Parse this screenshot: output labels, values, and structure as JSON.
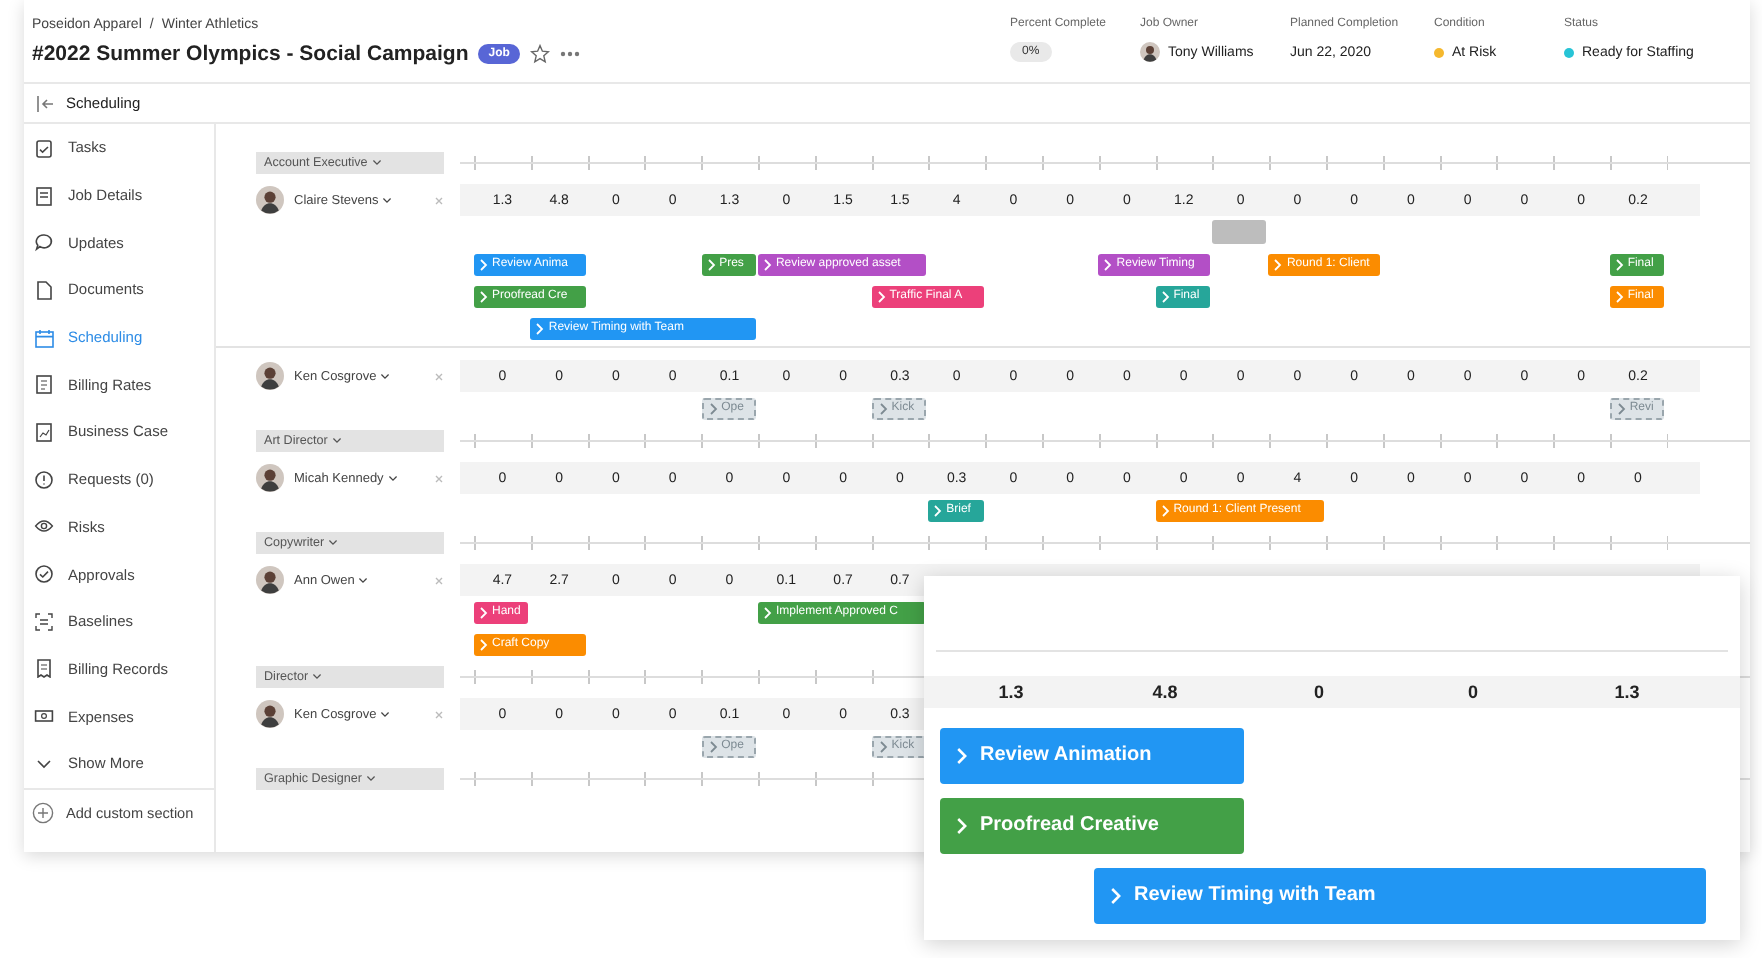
{
  "header": {
    "breadcrumb": [
      "Poseidon Apparel",
      "Winter Athletics"
    ],
    "separator": "/",
    "title": "#2022 Summer Olympics - Social Campaign",
    "badge": "Job",
    "fields": [
      {
        "label": "Percent Complete",
        "value": "0%",
        "kind": "pill"
      },
      {
        "label": "Job Owner",
        "value": "Tony Williams",
        "kind": "person"
      },
      {
        "label": "Planned Completion",
        "value": "Jun 22, 2020",
        "kind": "text"
      },
      {
        "label": "Condition",
        "value": "At Risk",
        "kind": "dot",
        "color": "#f5b82e"
      },
      {
        "label": "Status",
        "value": "Ready for Staffing",
        "kind": "dot",
        "color": "#27c4d6"
      }
    ]
  },
  "subheader": {
    "title": "Scheduling"
  },
  "sidebar": {
    "items": [
      {
        "label": "Tasks",
        "selected": false
      },
      {
        "label": "Job Details",
        "selected": false
      },
      {
        "label": "Updates",
        "selected": false
      },
      {
        "label": "Documents",
        "selected": false
      },
      {
        "label": "Scheduling",
        "selected": true
      },
      {
        "label": "Billing Rates",
        "selected": false
      },
      {
        "label": "Business Case",
        "selected": false
      },
      {
        "label": "Requests (0)",
        "selected": false
      },
      {
        "label": "Risks",
        "selected": false
      },
      {
        "label": "Approvals",
        "selected": false
      },
      {
        "label": "Baselines",
        "selected": false
      },
      {
        "label": "Billing Records",
        "selected": false
      },
      {
        "label": "Expenses",
        "selected": false
      }
    ],
    "show_more": "Show More",
    "add_section": "Add custom section"
  },
  "rows": [
    {
      "kind": "role",
      "label": "Account Executive"
    },
    {
      "kind": "person",
      "name": "Claire Stevens",
      "hours": [
        "1.3",
        "4.8",
        "0",
        "0",
        "1.3",
        "0",
        "1.5",
        "1.5",
        "4",
        "0",
        "0",
        "0",
        "1.2",
        "0",
        "0",
        "0",
        "0",
        "0",
        "0",
        "0",
        "0.2"
      ],
      "lanes": [
        [
          {
            "kind": "gap"
          },
          {
            "kind": "gap"
          },
          {
            "kind": "gap"
          },
          {
            "kind": "gap"
          },
          {
            "kind": "gap"
          },
          {
            "kind": "gap"
          },
          {
            "kind": "gap"
          },
          {
            "kind": "gap"
          },
          {
            "kind": "gap"
          },
          {
            "kind": "gap"
          },
          {
            "kind": "gap"
          },
          {
            "kind": "gap"
          },
          {
            "kind": "gap"
          },
          {
            "kind": "placeholder"
          }
        ],
        [
          {
            "kind": "task",
            "label": "Review Anima",
            "color": "#2196f3"
          },
          {
            "kind": "more"
          },
          {
            "kind": "gap"
          },
          {
            "kind": "gap"
          },
          {
            "kind": "task",
            "label": "Pres",
            "color": "#43a047"
          },
          {
            "kind": "task",
            "label": "Review approved asset",
            "color": "#b34fc6"
          },
          {
            "kind": "more"
          },
          {
            "kind": "more"
          },
          {
            "kind": "gap"
          },
          {
            "kind": "gap"
          },
          {
            "kind": "gap"
          },
          {
            "kind": "task",
            "label": "Review Timing",
            "color": "#b34fc6"
          },
          {
            "kind": "more"
          },
          {
            "kind": "gap"
          },
          {
            "kind": "task",
            "label": "Round 1: Client",
            "color": "#fb8c00"
          },
          {
            "kind": "more"
          },
          {
            "kind": "gap"
          },
          {
            "kind": "gap"
          },
          {
            "kind": "gap"
          },
          {
            "kind": "gap"
          },
          {
            "kind": "task",
            "label": "Final",
            "color": "#43a047"
          }
        ],
        [
          {
            "kind": "task",
            "label": "Proofread Cre",
            "color": "#43a047"
          },
          {
            "kind": "more"
          },
          {
            "kind": "gap"
          },
          {
            "kind": "gap"
          },
          {
            "kind": "gap"
          },
          {
            "kind": "gap"
          },
          {
            "kind": "gap"
          },
          {
            "kind": "task",
            "label": "Traffic Final A",
            "color": "#ec407a"
          },
          {
            "kind": "more"
          },
          {
            "kind": "gap"
          },
          {
            "kind": "gap"
          },
          {
            "kind": "gap"
          },
          {
            "kind": "task",
            "label": "Final",
            "color": "#26a69a"
          },
          {
            "kind": "gap"
          },
          {
            "kind": "gap"
          },
          {
            "kind": "gap"
          },
          {
            "kind": "gap"
          },
          {
            "kind": "gap"
          },
          {
            "kind": "gap"
          },
          {
            "kind": "gap"
          },
          {
            "kind": "task",
            "label": "Final",
            "color": "#fb8c00"
          }
        ],
        [
          {
            "kind": "gap"
          },
          {
            "kind": "task",
            "label": "Review Timing with Team",
            "color": "#2196f3"
          },
          {
            "kind": "more"
          },
          {
            "kind": "more"
          },
          {
            "kind": "more"
          }
        ]
      ]
    },
    {
      "kind": "person",
      "name": "Ken Cosgrove",
      "hours": [
        "0",
        "0",
        "0",
        "0",
        "0.1",
        "0",
        "0",
        "0.3",
        "0",
        "0",
        "0",
        "0",
        "0",
        "0",
        "0",
        "0",
        "0",
        "0",
        "0",
        "0",
        "0.2"
      ],
      "lanes": [
        [
          {
            "kind": "gap"
          },
          {
            "kind": "gap"
          },
          {
            "kind": "gap"
          },
          {
            "kind": "gap"
          },
          {
            "kind": "tentative",
            "label": "Ope"
          },
          {
            "kind": "gap"
          },
          {
            "kind": "gap"
          },
          {
            "kind": "tentative",
            "label": "Kick"
          },
          {
            "kind": "gap"
          },
          {
            "kind": "gap"
          },
          {
            "kind": "gap"
          },
          {
            "kind": "gap"
          },
          {
            "kind": "gap"
          },
          {
            "kind": "gap"
          },
          {
            "kind": "gap"
          },
          {
            "kind": "gap"
          },
          {
            "kind": "gap"
          },
          {
            "kind": "gap"
          },
          {
            "kind": "gap"
          },
          {
            "kind": "gap"
          },
          {
            "kind": "tentative",
            "label": "Revi"
          }
        ]
      ]
    },
    {
      "kind": "role",
      "label": "Art Director"
    },
    {
      "kind": "person",
      "name": "Micah Kennedy",
      "hours": [
        "0",
        "0",
        "0",
        "0",
        "0",
        "0",
        "0",
        "0",
        "0.3",
        "0",
        "0",
        "0",
        "0",
        "0",
        "4",
        "0",
        "0",
        "0",
        "0",
        "0",
        "0"
      ],
      "lanes": [
        [
          {
            "kind": "gap"
          },
          {
            "kind": "gap"
          },
          {
            "kind": "gap"
          },
          {
            "kind": "gap"
          },
          {
            "kind": "gap"
          },
          {
            "kind": "gap"
          },
          {
            "kind": "gap"
          },
          {
            "kind": "gap"
          },
          {
            "kind": "task",
            "label": "Brief",
            "color": "#26a69a"
          },
          {
            "kind": "gap"
          },
          {
            "kind": "gap"
          },
          {
            "kind": "gap"
          },
          {
            "kind": "task",
            "label": "Round 1: Client Present",
            "color": "#fb8c00"
          },
          {
            "kind": "more"
          },
          {
            "kind": "more"
          }
        ]
      ]
    },
    {
      "kind": "role",
      "label": "Copywriter"
    },
    {
      "kind": "person",
      "name": "Ann Owen",
      "hours": [
        "4.7",
        "2.7",
        "0",
        "0",
        "0",
        "0.1",
        "0.7",
        "0.7"
      ],
      "lanes": [
        [
          {
            "kind": "task",
            "label": "Hand",
            "color": "#ec407a"
          },
          {
            "kind": "gap"
          },
          {
            "kind": "gap"
          },
          {
            "kind": "gap"
          },
          {
            "kind": "gap"
          },
          {
            "kind": "task",
            "label": "Implement Approved C",
            "color": "#43a047"
          },
          {
            "kind": "more"
          },
          {
            "kind": "more"
          }
        ],
        [
          {
            "kind": "task",
            "label": "Craft Copy",
            "color": "#fb8c00"
          },
          {
            "kind": "more"
          }
        ]
      ]
    },
    {
      "kind": "role",
      "label": "Director"
    },
    {
      "kind": "person",
      "name": "Ken Cosgrove",
      "hours": [
        "0",
        "0",
        "0",
        "0",
        "0.1",
        "0",
        "0",
        "0.3"
      ],
      "lanes": [
        [
          {
            "kind": "gap"
          },
          {
            "kind": "gap"
          },
          {
            "kind": "gap"
          },
          {
            "kind": "gap"
          },
          {
            "kind": "tentative",
            "label": "Ope"
          },
          {
            "kind": "gap"
          },
          {
            "kind": "gap"
          },
          {
            "kind": "tentative",
            "label": "Kick"
          }
        ]
      ]
    },
    {
      "kind": "role",
      "label": "Graphic Designer"
    }
  ],
  "zoom": {
    "hours": [
      "1.3",
      "4.8",
      "0",
      "0",
      "1.3"
    ],
    "lanes": [
      [
        {
          "kind": "task",
          "label": "Review Animation",
          "color": "#2196f3"
        },
        {
          "kind": "more"
        }
      ],
      [
        {
          "kind": "task",
          "label": "Proofread Creative",
          "color": "#43a047"
        },
        {
          "kind": "more"
        }
      ],
      [
        {
          "kind": "gap"
        },
        {
          "kind": "task",
          "label": "Review Timing with Team",
          "color": "#2196f3"
        },
        {
          "kind": "more"
        },
        {
          "kind": "more"
        },
        {
          "kind": "more"
        }
      ]
    ]
  }
}
